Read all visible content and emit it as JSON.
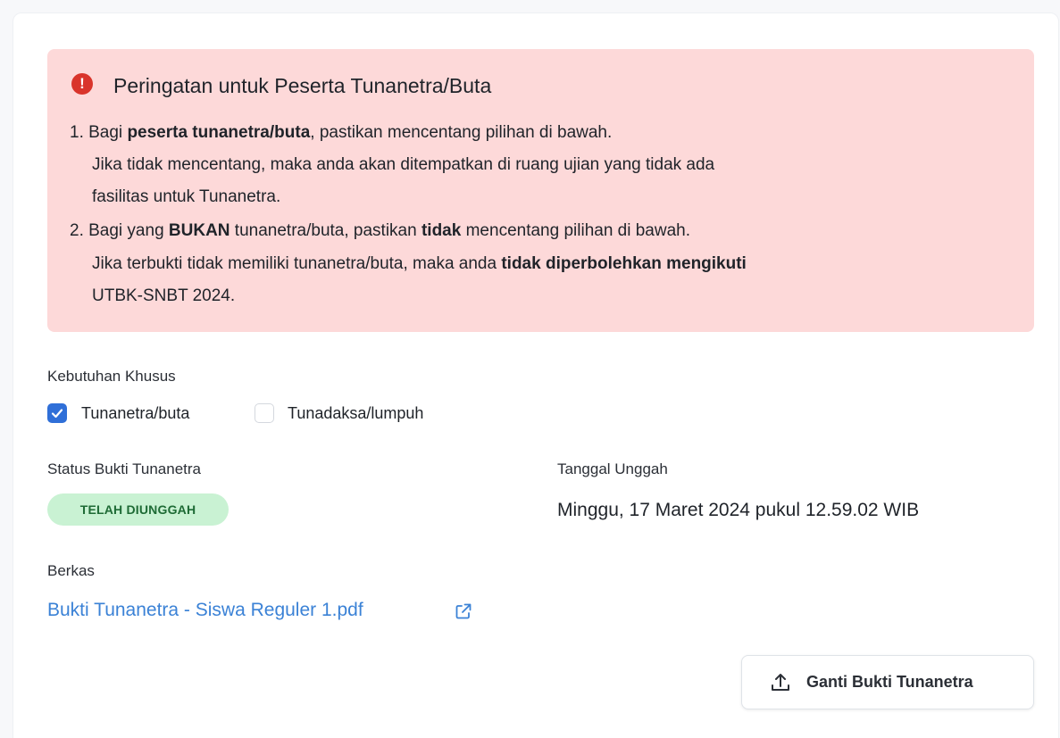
{
  "alert": {
    "icon": "exclamation-circle-icon",
    "color": "#d9342b",
    "background": "#fdd9d9",
    "title": "Peringatan untuk Peserta Tunanetra/Buta",
    "item1": {
      "prefix": "1. Bagi ",
      "bold": "peserta tunanetra/buta",
      "suffix": ", pastikan mencentang pilihan di bawah.",
      "line2": "Jika tidak mencentang, maka anda akan ditempatkan di ruang ujian yang tidak ada",
      "line3": "fasilitas untuk Tunanetra."
    },
    "item2": {
      "prefix": "2. Bagi yang ",
      "bold1": "BUKAN",
      "mid": " tunanetra/buta, pastikan ",
      "bold2": "tidak",
      "suffix": " mencentang pilihan di bawah.",
      "line2_prefix": "Jika terbukti tidak memiliki tunanetra/buta, maka anda ",
      "line2_bold": "tidak diperbolehkan mengikuti",
      "line3": "UTBK-SNBT 2024."
    }
  },
  "special_needs": {
    "label": "Kebutuhan Khusus",
    "options": [
      {
        "label": "Tunanetra/buta",
        "checked": true
      },
      {
        "label": "Tunadaksa/lumpuh",
        "checked": false
      }
    ]
  },
  "proof_status": {
    "label": "Status Bukti Tunanetra",
    "badge": "TELAH DIUNGGAH",
    "badge_color": "#c9f2d3"
  },
  "upload_date": {
    "label": "Tanggal Unggah",
    "value": "Minggu, 17 Maret 2024 pukul 12.59.02 WIB"
  },
  "file": {
    "label": "Berkas",
    "name": "Bukti Tunanetra - Siswa Reguler 1.pdf",
    "link_color": "#3b82d6",
    "icon": "external-link-icon"
  },
  "replace_button": {
    "label": "Ganti Bukti Tunanetra",
    "icon": "upload-icon"
  }
}
